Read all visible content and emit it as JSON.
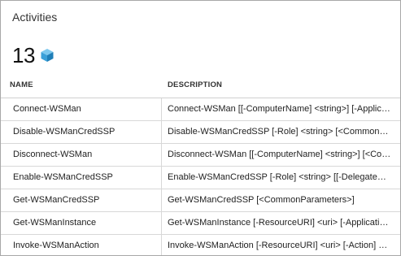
{
  "panel": {
    "title": "Activities",
    "count": "13",
    "count_icon": "cube-icon",
    "accent_color": "#3aa0d8"
  },
  "table": {
    "columns": [
      "NAME",
      "DESCRIPTION"
    ],
    "rows": [
      {
        "name": "Connect-WSMan",
        "description": "Connect-WSMan [[-ComputerName] <string>] [-ApplicationName <string>]"
      },
      {
        "name": "Disable-WSManCredSSP",
        "description": "Disable-WSManCredSSP [-Role] <string> [<CommonParameters>]"
      },
      {
        "name": "Disconnect-WSMan",
        "description": "Disconnect-WSMan [[-ComputerName] <string>] [<CommonParameters>]"
      },
      {
        "name": "Enable-WSManCredSSP",
        "description": "Enable-WSManCredSSP [-Role] <string> [[-DelegateComputer] <string[]>]"
      },
      {
        "name": "Get-WSManCredSSP",
        "description": "Get-WSManCredSSP [<CommonParameters>]"
      },
      {
        "name": "Get-WSManInstance",
        "description": "Get-WSManInstance [-ResourceURI] <uri> [-ApplicationName <string>]"
      },
      {
        "name": "Invoke-WSManAction",
        "description": "Invoke-WSManAction [-ResourceURI] <uri> [-Action] <string>"
      }
    ]
  }
}
